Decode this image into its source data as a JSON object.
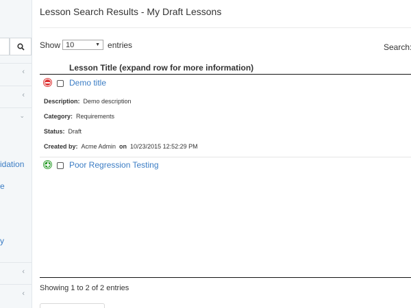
{
  "sidebar": {
    "search_icon": "search-icon",
    "partial_labels": [
      "idation",
      "e",
      "y"
    ],
    "arrows": [
      "chevron-left-icon",
      "chevron-left-icon",
      "chevron-down-icon",
      "chevron-left-icon",
      "chevron-left-icon"
    ]
  },
  "page": {
    "title": "Lesson Search Results - My Draft Lessons"
  },
  "controls": {
    "show_label": "Show",
    "entries_value": "10",
    "entries_label": "entries",
    "search_label": "Search:"
  },
  "table": {
    "column_header": "Lesson Title (expand row for more information)",
    "rows": [
      {
        "title": "Demo title",
        "expanded": true,
        "details": {
          "description_label": "Description:",
          "description": "Demo description",
          "category_label": "Category:",
          "category": "Requirements",
          "status_label": "Status:",
          "status": "Draft",
          "created_by_label": "Created by:",
          "created_by": "Acme Admin",
          "on_label": "on",
          "created_on": "10/23/2015 12:52:29 PM"
        }
      },
      {
        "title": "Poor Regression Testing",
        "expanded": false
      }
    ],
    "info": "Showing 1 to 2 of 2 entries"
  },
  "colors": {
    "link": "#3a7cc4",
    "collapse_toggle": "#dd3333",
    "expand_toggle": "#31a031"
  }
}
